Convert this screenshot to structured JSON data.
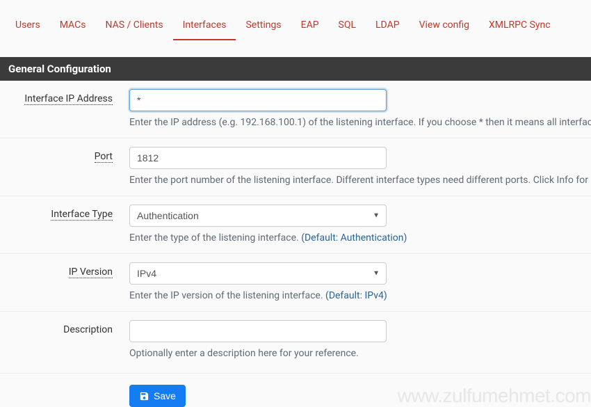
{
  "tabs": {
    "items": [
      "Users",
      "MACs",
      "NAS / Clients",
      "Interfaces",
      "Settings",
      "EAP",
      "SQL",
      "LDAP",
      "View config",
      "XMLRPC Sync"
    ],
    "active_index": 3
  },
  "section_title": "General Configuration",
  "fields": {
    "ip": {
      "label": "Interface IP Address",
      "value": "*",
      "help": "Enter the IP address (e.g. 192.168.100.1) of the listening interface. If you choose * then it means all interfaces."
    },
    "port": {
      "label": "Port",
      "value": "1812",
      "help": "Enter the port number of the listening interface. Different interface types need different ports. Click Info for deta"
    },
    "iftype": {
      "label": "Interface Type",
      "value": "Authentication",
      "help_prefix": "Enter the type of the listening interface. ",
      "help_link": "(Default: Authentication)"
    },
    "ipver": {
      "label": "IP Version",
      "value": "IPv4",
      "help_prefix": "Enter the IP version of the listening interface. ",
      "help_link": "(Default: IPv4)"
    },
    "desc": {
      "label": "Description",
      "value": "",
      "help": "Optionally enter a description here for your reference."
    }
  },
  "save_label": "Save",
  "watermark": "www.zulfumehmet.com"
}
